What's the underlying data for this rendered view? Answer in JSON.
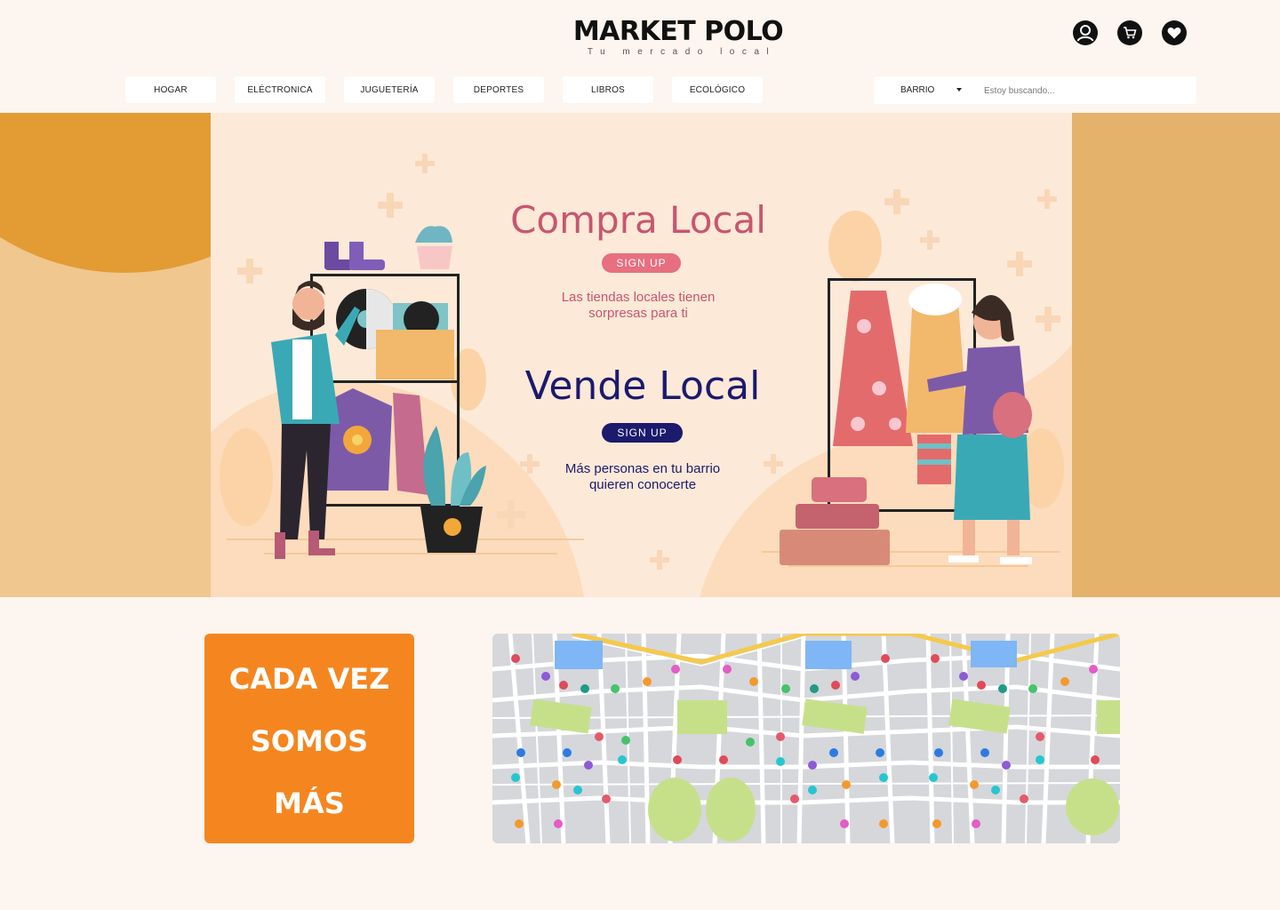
{
  "header": {
    "logo_title": "MARKET POLO",
    "logo_subtitle": "Tu mercado local",
    "icons": [
      "user-icon",
      "cart-icon",
      "heart-icon"
    ]
  },
  "nav": {
    "categories": [
      "HOGAR",
      "ELÉCTRONICA",
      "JUGUETERÍA",
      "DEPORTES",
      "LIBROS",
      "ECOLÓGICO"
    ]
  },
  "search": {
    "filter_label": "BARRIO",
    "placeholder": "Estoy buscando..."
  },
  "hero": {
    "buy_title": "Compra Local",
    "buy_button": "SIGN UP",
    "buy_text_1": "Las tiendas locales tienen",
    "buy_text_2": "sorpresas para ti",
    "sell_title": "Vende Local",
    "sell_button": "SIGN UP",
    "sell_text_1": "Más personas en tu barrio",
    "sell_text_2": "quieren conocerte"
  },
  "promo": {
    "line1": "CADA VEZ",
    "line2": "SOMOS",
    "line3": "MÁS"
  },
  "colors": {
    "background": "#fdf5ef",
    "brand_pink": "#c7566f",
    "brand_navy": "#1b1a6d",
    "promo_orange": "#f5861f",
    "hero_bg": "#fde9d8"
  }
}
